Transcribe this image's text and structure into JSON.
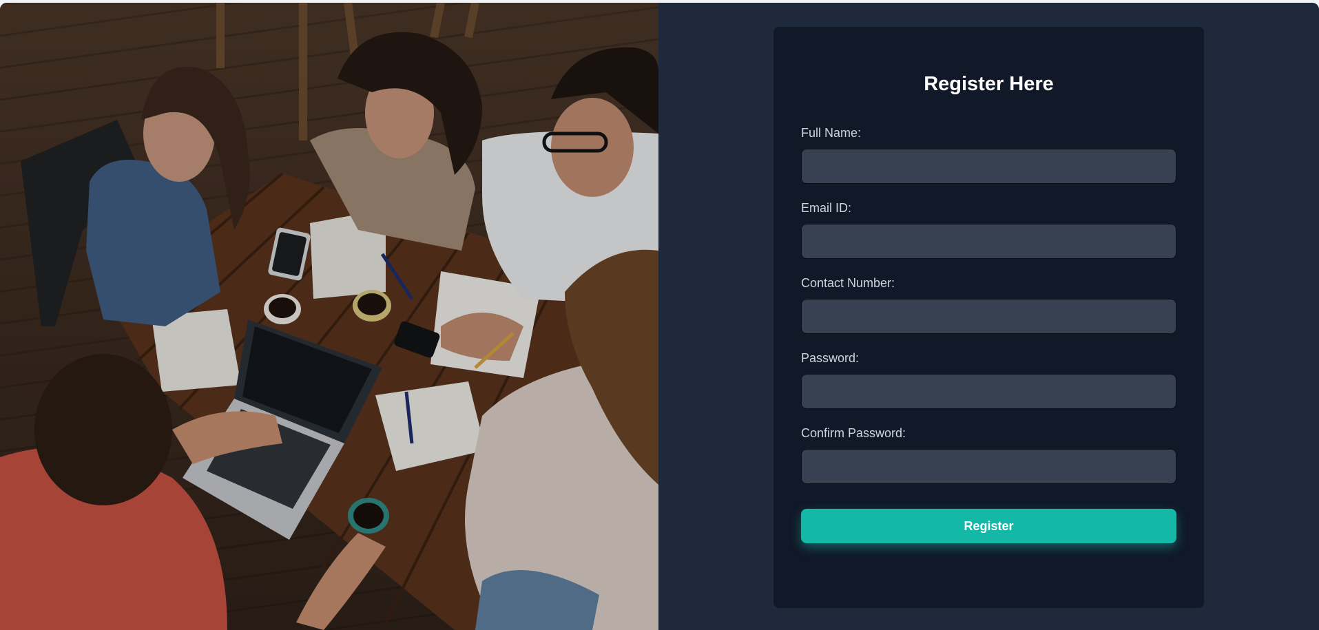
{
  "form": {
    "title": "Register Here",
    "fields": [
      {
        "label": "Full Name:",
        "value": "",
        "placeholder": ""
      },
      {
        "label": "Email ID:",
        "value": "",
        "placeholder": ""
      },
      {
        "label": "Contact Number:",
        "value": "",
        "placeholder": ""
      },
      {
        "label": "Password:",
        "value": "",
        "placeholder": ""
      },
      {
        "label": "Confirm Password:",
        "value": "",
        "placeholder": ""
      }
    ],
    "submit_label": "Register"
  },
  "colors": {
    "page_background": "#1e293b",
    "card_background": "#111827",
    "input_background": "#374151",
    "accent": "#14b8a6"
  }
}
